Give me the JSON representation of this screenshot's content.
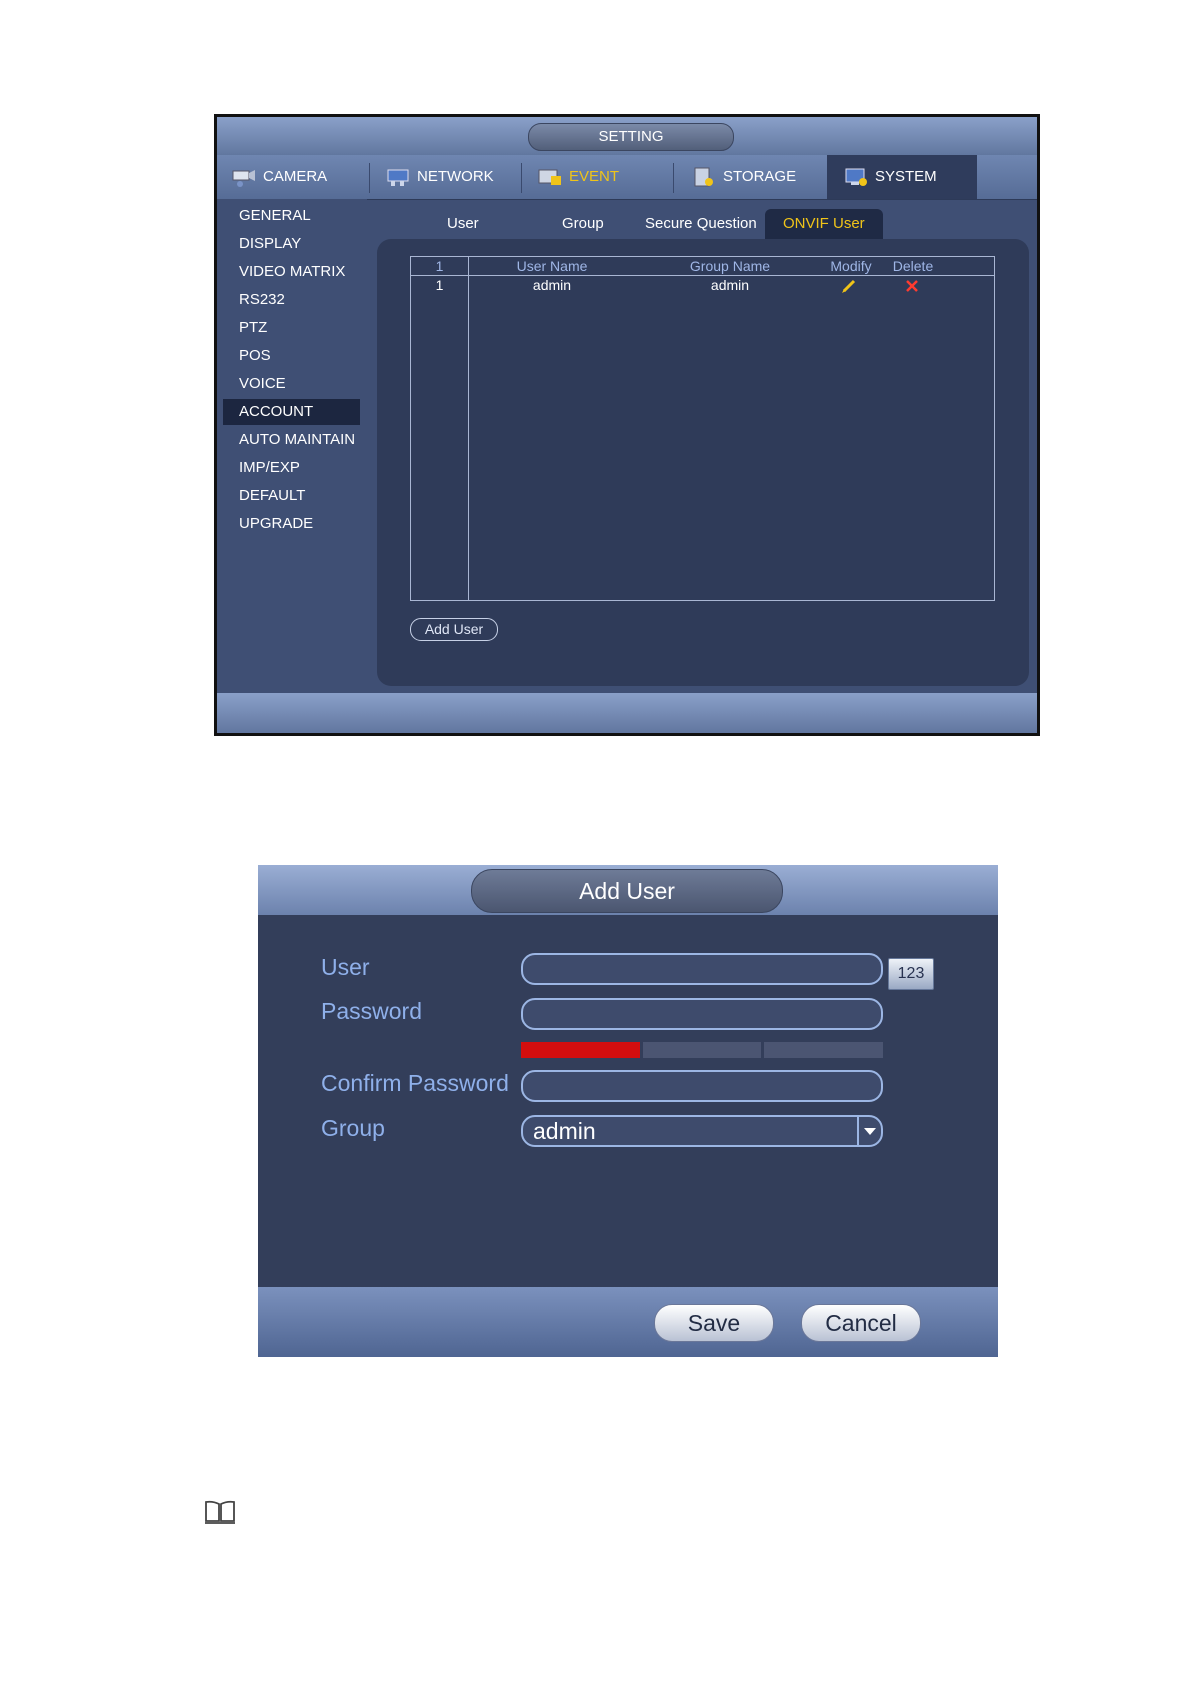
{
  "setting_window": {
    "title": "SETTING",
    "tabs": [
      {
        "label": "CAMERA",
        "icon": "camera-icon"
      },
      {
        "label": "NETWORK",
        "icon": "network-icon"
      },
      {
        "label": "EVENT",
        "icon": "event-icon"
      },
      {
        "label": "STORAGE",
        "icon": "storage-icon"
      },
      {
        "label": "SYSTEM",
        "icon": "system-icon"
      }
    ],
    "active_tab": "SYSTEM",
    "sidebar": {
      "items": [
        "GENERAL",
        "DISPLAY",
        "VIDEO MATRIX",
        "RS232",
        "PTZ",
        "POS",
        "VOICE",
        "ACCOUNT",
        "AUTO MAINTAIN",
        "IMP/EXP",
        "DEFAULT",
        "UPGRADE"
      ],
      "selected": "ACCOUNT"
    },
    "subtabs": [
      "User",
      "Group",
      "Secure Question",
      "ONVIF User"
    ],
    "active_subtab": "ONVIF User",
    "table": {
      "headers": [
        "1",
        "User Name",
        "Group Name",
        "Modify",
        "Delete"
      ],
      "rows": [
        {
          "index": "1",
          "user_name": "admin",
          "group_name": "admin"
        }
      ]
    },
    "add_user_button": "Add User"
  },
  "add_user_dialog": {
    "title": "Add User",
    "fields": {
      "user_label": "User",
      "user_value": "",
      "keyboard_button": "123",
      "password_label": "Password",
      "password_value": "",
      "confirm_label": "Confirm Password",
      "confirm_value": "",
      "group_label": "Group",
      "group_value": "admin"
    },
    "password_strength_level": 1,
    "save_button": "Save",
    "cancel_button": "Cancel"
  },
  "colors": {
    "active_highlight": "#f0c419",
    "panel": "#2f3b59",
    "strength_red": "#d40e0e",
    "label_blue": "#8fb0ea"
  }
}
